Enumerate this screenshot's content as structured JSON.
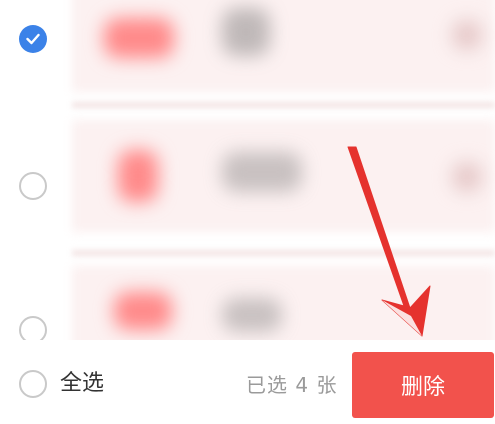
{
  "list": {
    "items": [
      {
        "checked": true
      },
      {
        "checked": false
      },
      {
        "checked": false
      }
    ]
  },
  "footer": {
    "select_all_label": "全选",
    "selected_count_text": "已选 4 张",
    "delete_label": "删除"
  },
  "colors": {
    "accent_blue": "#3b82e8",
    "delete_red": "#f2524c",
    "annotation_arrow": "#e5322e"
  }
}
